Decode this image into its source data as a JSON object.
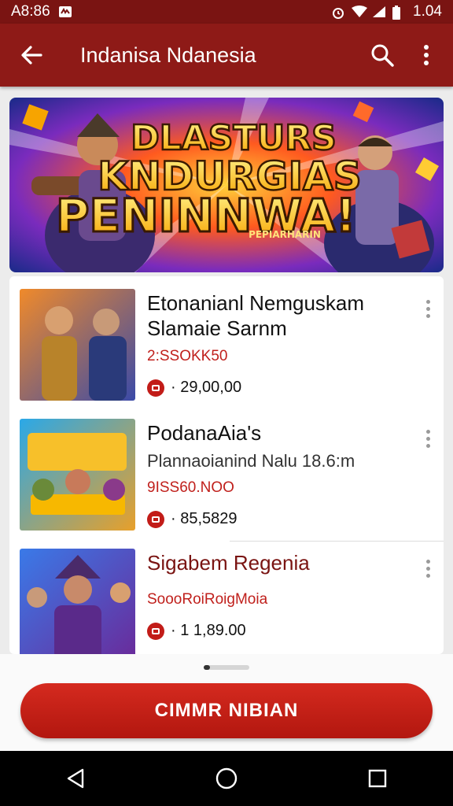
{
  "status_bar": {
    "time": "A8:86",
    "battery": "1.04",
    "icons": [
      "notification-icon",
      "alarm-icon",
      "wifi-icon",
      "signal-icon",
      "battery-icon"
    ]
  },
  "app_bar": {
    "title": "Indanisa Ndanesia",
    "icons": [
      "back-arrow-icon",
      "search-icon",
      "more-vert-icon"
    ]
  },
  "banner": {
    "line1": "DLASTURS",
    "line2": "KNDURGIAS",
    "line3": "PENINNWA!",
    "tag": "PEPIARHARIN"
  },
  "items": [
    {
      "name": "Etonanianl Nemguskam",
      "subtitle": "Slamaie Sarnm",
      "code": "2:SSOKK50",
      "price": "· 29,00,00"
    },
    {
      "name": "PodanaAia's",
      "subtitle": "Plannaoianind Nalu 18.6:m",
      "code": "9ISS60.NOO",
      "price": "· 85,5829"
    },
    {
      "name": "Sigabem Regenia",
      "subtitle": "",
      "code": "SoooRoiRoigMoia",
      "price": "· 1 1,89.00"
    }
  ],
  "cta": {
    "label": "CIMMR NIBIAN"
  },
  "colors": {
    "accent": "#8e1a17",
    "status": "#7a1412",
    "price_red": "#c0201c",
    "cta": "#c8221a"
  }
}
